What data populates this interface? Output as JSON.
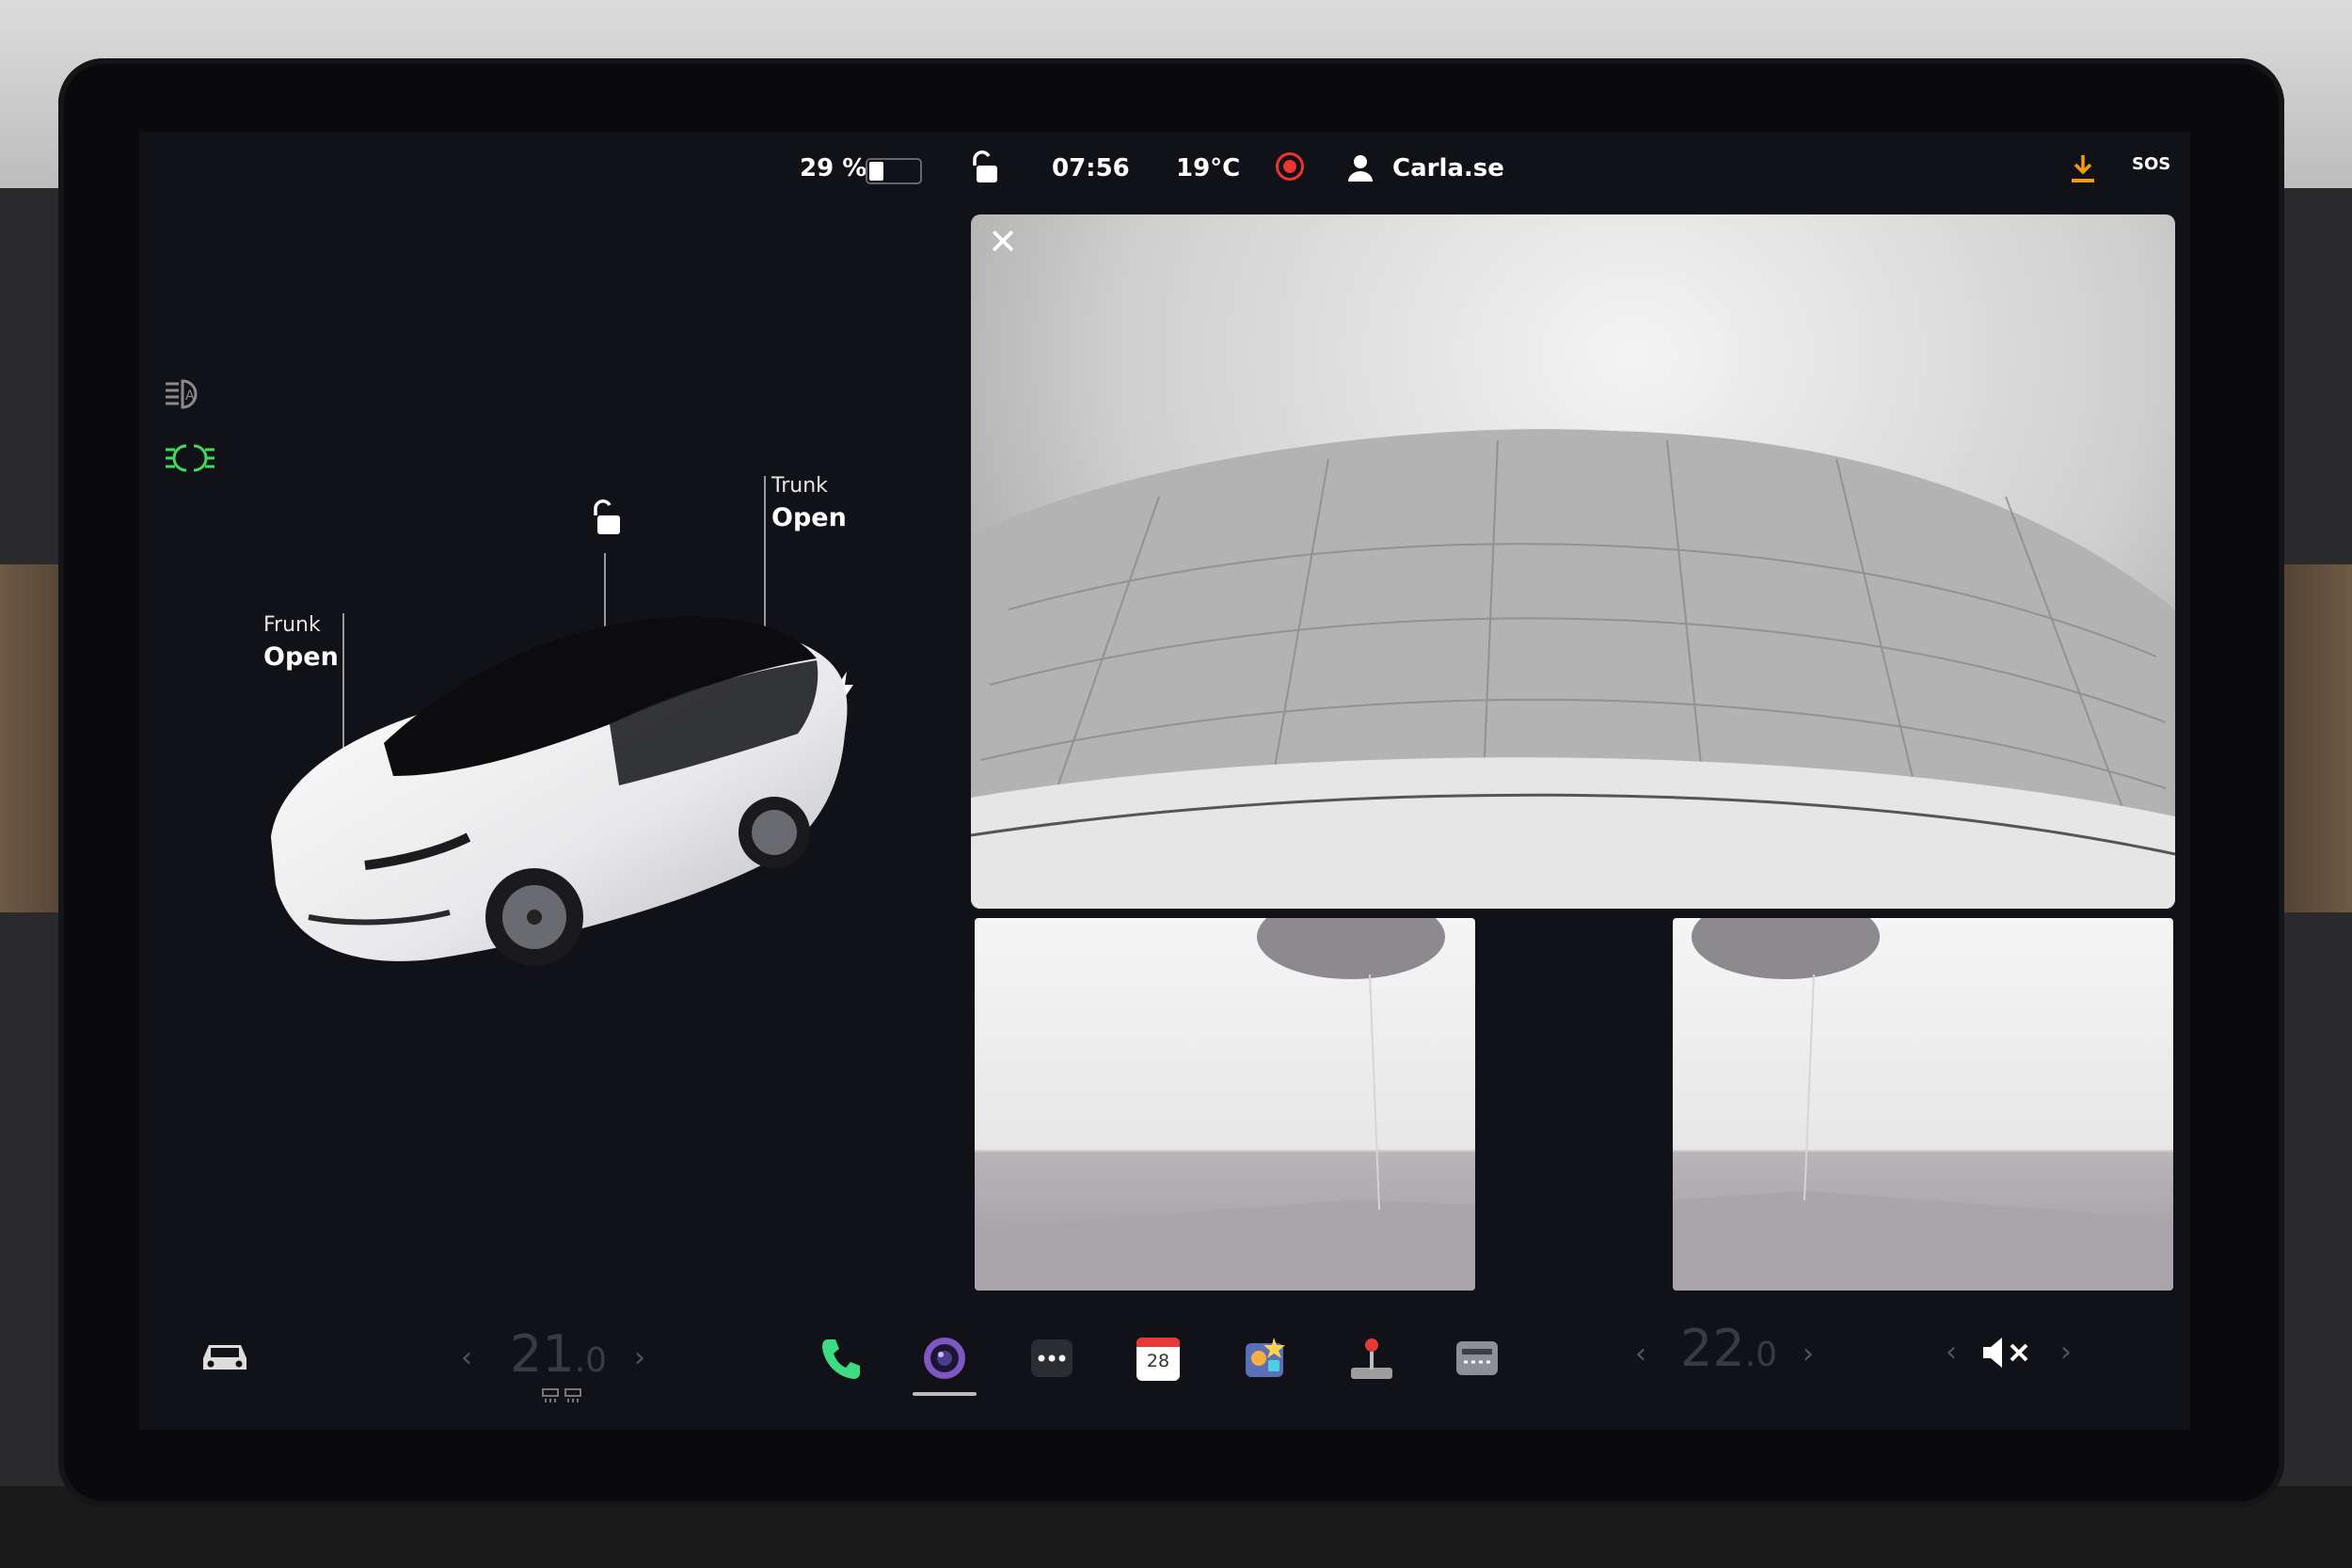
{
  "status_bar": {
    "battery_percent": "29 %",
    "battery_level": 0.29,
    "time": "07:56",
    "temperature": "19°C",
    "profile_name": "Carla.se",
    "sos_label": "SOS"
  },
  "vehicle": {
    "frunk_label": "Frunk",
    "frunk_status": "Open",
    "trunk_label": "Trunk",
    "trunk_status": "Open"
  },
  "dock": {
    "driver_temp": "21",
    "driver_temp_decimal": ".0",
    "passenger_temp": "22",
    "passenger_temp_decimal": ".0",
    "calendar_day": "28"
  },
  "colors": {
    "headlight_icon": "#3fdc5c",
    "recording": "#e33333",
    "download": "#f39c12",
    "phone": "#3ddc84",
    "camera_app": "#7e57c2"
  }
}
